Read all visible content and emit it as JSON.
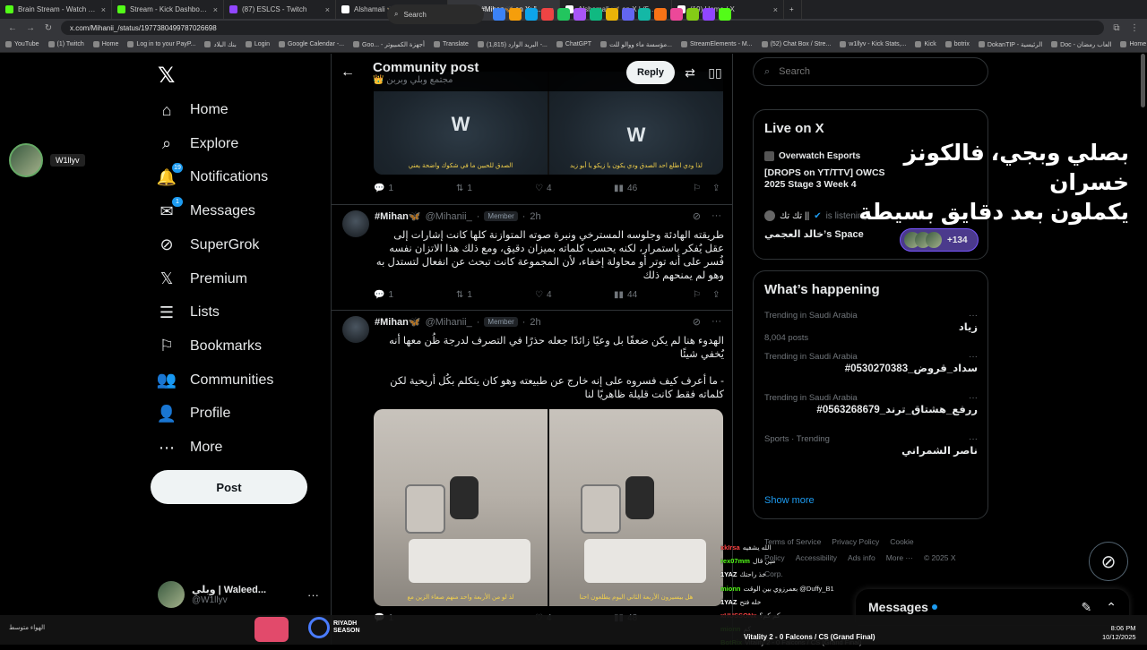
{
  "browser": {
    "tabs": [
      {
        "title": "Brain Stream - Watch Live on K",
        "color": "#53fc18"
      },
      {
        "title": "Stream - Kick Dashboard",
        "color": "#53fc18"
      },
      {
        "title": "(87) ESLCS - Twitch",
        "color": "#9146ff"
      },
      {
        "title": "Alshamali 🦋 on X | وبلي (20)",
        "color": "#ffffff"
      },
      {
        "title": "(20) #Mihan🦋 on X: \"- 5#",
        "color": "#ffffff",
        "active": true
      },
      {
        "title": "Alshamali 🦋 on X | وبلي (5)",
        "color": "#ffffff"
      },
      {
        "title": "(19) Home / X",
        "color": "#ffffff"
      }
    ],
    "url": "x.com/Mihanii_/status/1977380499787026698",
    "bookmarks": [
      "YouTube",
      "(1) Twitch",
      "Home",
      "Log in to your PayP...",
      "بنك البلاد",
      "Login",
      "Google Calendar -...",
      "Goo... - أجهزة الكمبيوتر",
      "Translate",
      "(1,815) البريد الوارد -...",
      "ChatGPT",
      "مؤسسة ماء ووالو للت...",
      "StreamElements - M...",
      "(52) Chat Box / Stre...",
      "w1llyv - Kick Stats,...",
      "Kick",
      "botrix",
      "DokanTIP - الرئيسية",
      "Doc - العاب رمضان",
      "Home - Restream",
      "All Bookmarks"
    ]
  },
  "nav": {
    "items": [
      {
        "label": "Home",
        "icon": "home-icon",
        "glyph": "⌂"
      },
      {
        "label": "Explore",
        "icon": "search-icon",
        "glyph": "⌕"
      },
      {
        "label": "Notifications",
        "icon": "bell-icon",
        "glyph": "🔔",
        "badge": "19"
      },
      {
        "label": "Messages",
        "icon": "mail-icon",
        "glyph": "✉",
        "badge": "1"
      },
      {
        "label": "SuperGrok",
        "icon": "grok-icon",
        "glyph": "⊘"
      },
      {
        "label": "Premium",
        "icon": "x-icon",
        "glyph": "𝕏"
      },
      {
        "label": "Lists",
        "icon": "list-icon",
        "glyph": "☰"
      },
      {
        "label": "Bookmarks",
        "icon": "bookmark-icon",
        "glyph": "⚐"
      },
      {
        "label": "Communities",
        "icon": "people-icon",
        "glyph": "👥"
      },
      {
        "label": "Profile",
        "icon": "person-icon",
        "glyph": "👤"
      },
      {
        "label": "More",
        "icon": "more-icon",
        "glyph": "⋯"
      }
    ],
    "post_label": "Post",
    "account": {
      "name": "وبلي | Waleed...",
      "handle": "@W1llyv"
    }
  },
  "streamer": {
    "name": "W1llyv"
  },
  "center": {
    "title": "Community post",
    "subtitle": "مجتمع وبلي وبربن 👑",
    "reply_label": "Reply",
    "first_media": {
      "caption_left": "الصدق للحبين ما في شكوك واضحة يعني",
      "caption_right": "لذا ودي اطلع احد الصدق ودي يكون يا زيكو يا أبو زيد"
    },
    "first_actions": {
      "reply": "1",
      "repost": "1",
      "like": "4",
      "views": "46"
    },
    "posts": [
      {
        "name": "#Mihan🦋",
        "handle": "@Mihanii_",
        "badge": "Member",
        "time": "2h",
        "text": "طريقته الهادئة وجلوسه المسترخي ونبرة صوته المتوازنة كلها كانت إشارات إلى عقل يُفكر باستمرار، لكنه يحسب كلماته بميزان دقيق، ومع ذلك هذا الاتزان نفسه فُسر على أنه توتر أو محاولة إخفاء، لأن المجموعة كانت تبحث عن انفعال لتستدل به وهو لم يمنحهم ذلك",
        "actions": {
          "reply": "1",
          "repost": "1",
          "like": "4",
          "views": "44"
        }
      },
      {
        "name": "#Mihan🦋",
        "handle": "@Mihanii_",
        "badge": "Member",
        "time": "2h",
        "text": "الهدوء هنا لم يكن ضعفًا بل وعيًا زائدًا جعله حذرًا في التصرف لدرجة ظُن معها أنه يُخفي شيئًا",
        "text2": "- ما أعرف كيف فسروه على إنه خارج عن طبيعته وهو كان يتكلم بكُل أريحية لكن كلماته فقط كانت قليلة ظاهريًا لنا",
        "media_caption_left": "لذ لو من الأربعة واحد منهم صعاء الزين مع",
        "media_caption_right": "هل بيسيرون الأربعة الثاني اليوم يطلعون احنا",
        "actions": {
          "reply": "1",
          "like": "4",
          "views": "48"
        }
      }
    ]
  },
  "right": {
    "search_placeholder": "Search",
    "live": {
      "title": "Live on X",
      "event_name": "Overwatch Esports",
      "event_title": "[DROPS on YT/TTV] OWCS 2025 Stage 3 Week 4",
      "listener_name": "تك تك ||",
      "listening": "is listening",
      "space": "خالد العجمي’s Space",
      "count": "+134"
    },
    "happening": {
      "title": "What’s happening",
      "trends": [
        {
          "cat": "Trending in Saudi Arabia",
          "topic": "زياد",
          "count": "8,004 posts"
        },
        {
          "cat": "Trending in Saudi Arabia",
          "topic": "#سداد_قروض_0530270383",
          "count": ""
        },
        {
          "cat": "Trending in Saudi Arabia",
          "topic": "#ررفع_هشتاق_ترند_0563268679",
          "count": ""
        },
        {
          "cat": "Sports · Trending",
          "topic": "ناصر الشمراني",
          "count": ""
        }
      ],
      "show_more": "Show more"
    },
    "footer": [
      "Terms of Service",
      "Privacy Policy",
      "Cookie Policy",
      "Accessibility",
      "Ads info",
      "More ···",
      "© 2025 X Corp."
    ],
    "messages_label": "Messages"
  },
  "overlay_text": {
    "line1": "بصلي وبجي، فالكونز خسران",
    "line2": "يكملون بعد دقايق بسيطة"
  },
  "chat": [
    {
      "user": "xkIrsa",
      "msg": "الله يشفيه",
      "color": "#ff4444"
    },
    {
      "user": "rex07mm",
      "msg": "مين قال",
      "color": "#53fc18"
    },
    {
      "user": "1YAZ",
      "msg": "خذ راحتك",
      "color": "#ffffff"
    },
    {
      "user": "mionn",
      "msg": "بعمرزوي بين الوقت @Duffy_B1",
      "color": "#53fc18"
    },
    {
      "user": "1YAZ",
      "msg": "خله فتح",
      "color": "#ffffff"
    },
    {
      "user": "xHUSSONx",
      "msg": "كم كم؟",
      "color": "#ff4444"
    },
    {
      "user": "mionn",
      "msg": "كم",
      "color": "#53fc18"
    },
    {
      "user": "BotRix",
      "msg": "Vitality 2 - 0 Falcons / CS (Grand Final)",
      "color": "#53fc18"
    }
  ],
  "taskbar": {
    "search_label": "Search",
    "riyadh": "RIYADH SEASON",
    "time": "8:06 PM",
    "date": "10/12/2025",
    "weather": "الهواء متوسط"
  }
}
